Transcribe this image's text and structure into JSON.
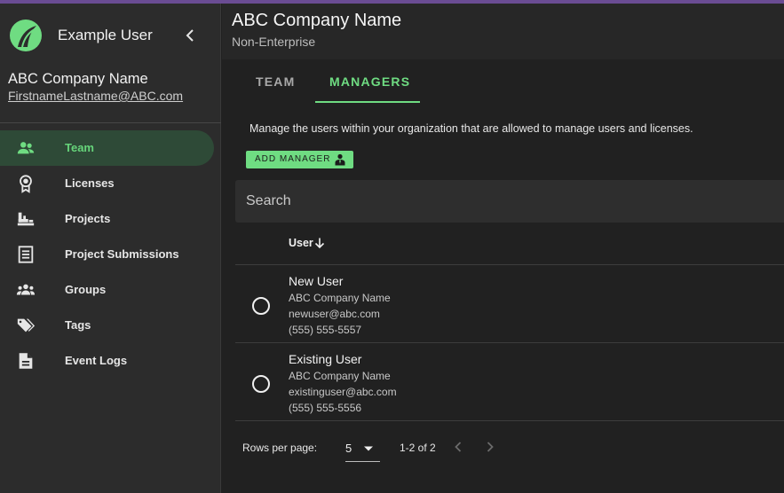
{
  "sidebar": {
    "user_name": "Example User",
    "company_name": "ABC Company Name",
    "email": "FirstnameLastname@ABC.com",
    "items": [
      {
        "label": "Team",
        "icon": "team-icon",
        "active": true
      },
      {
        "label": "Licenses",
        "icon": "license-badge-icon"
      },
      {
        "label": "Projects",
        "icon": "projects-icon"
      },
      {
        "label": "Project Submissions",
        "icon": "submissions-icon"
      },
      {
        "label": "Groups",
        "icon": "groups-icon"
      },
      {
        "label": "Tags",
        "icon": "tags-icon"
      },
      {
        "label": "Event Logs",
        "icon": "event-logs-icon"
      }
    ]
  },
  "header": {
    "title": "ABC Company Name",
    "subtitle": "Non-Enterprise"
  },
  "tabs": [
    {
      "label": "TEAM",
      "active": false
    },
    {
      "label": "MANAGERS",
      "active": true
    }
  ],
  "managers": {
    "description": "Manage the users within your organization that are allowed to manage users and licenses.",
    "add_button": "ADD MANAGER",
    "search_placeholder": "Search",
    "column_user": "User",
    "rows": [
      {
        "name": "New User",
        "company": "ABC Company Name",
        "email": "newuser@abc.com",
        "phone": "(555) 555-5557"
      },
      {
        "name": "Existing User",
        "company": "ABC Company Name",
        "email": "existinguser@abc.com",
        "phone": "(555) 555-5556"
      }
    ]
  },
  "pagination": {
    "rows_per_page_label": "Rows per page:",
    "rows_per_page": "5",
    "range": "1-2 of 2"
  },
  "colors": {
    "accent": "#6fdc82",
    "background": "#212121",
    "sidebar": "#2c2c2c",
    "active_nav": "#2e4a37"
  }
}
